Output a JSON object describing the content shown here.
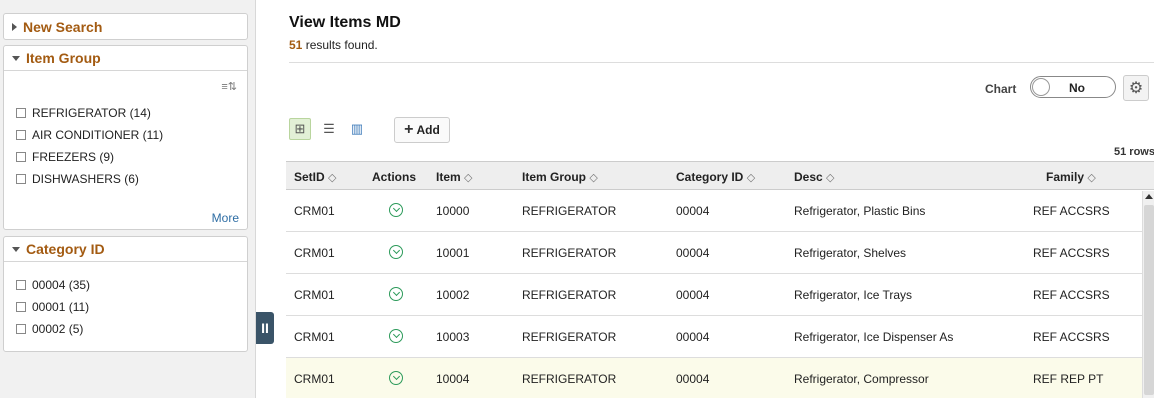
{
  "left_panel": {
    "new_search": {
      "label": "New Search"
    },
    "item_group": {
      "title": "Item Group",
      "options": [
        {
          "label": "REFRIGERATOR (14)"
        },
        {
          "label": "AIR CONDITIONER (11)"
        },
        {
          "label": "FREEZERS (9)"
        },
        {
          "label": "DISHWASHERS (6)"
        }
      ],
      "more": "More"
    },
    "category_id": {
      "title": "Category ID",
      "options": [
        {
          "label": "00004 (35)"
        },
        {
          "label": "00001 (11)"
        },
        {
          "label": "00002 (5)"
        }
      ]
    },
    "collapse_glyph": "II"
  },
  "main": {
    "title": "View Items MD",
    "results_count": "51",
    "results_text": "results found.",
    "chart_label": "Chart",
    "chart_toggle_value": "No",
    "add_label": "Add",
    "row_count": "51 rows"
  },
  "grid": {
    "columns": [
      "SetID",
      "Actions",
      "Item",
      "Item Group",
      "Category ID",
      "Desc",
      "Family"
    ],
    "rows": [
      {
        "setid": "CRM01",
        "item": "10000",
        "group": "REFRIGERATOR",
        "cat": "00004",
        "desc": "Refrigerator, Plastic Bins",
        "family": "REF ACCSRS"
      },
      {
        "setid": "CRM01",
        "item": "10001",
        "group": "REFRIGERATOR",
        "cat": "00004",
        "desc": "Refrigerator, Shelves",
        "family": "REF ACCSRS"
      },
      {
        "setid": "CRM01",
        "item": "10002",
        "group": "REFRIGERATOR",
        "cat": "00004",
        "desc": "Refrigerator, Ice Trays",
        "family": "REF ACCSRS"
      },
      {
        "setid": "CRM01",
        "item": "10003",
        "group": "REFRIGERATOR",
        "cat": "00004",
        "desc": "Refrigerator, Ice Dispenser As",
        "family": "REF ACCSRS"
      },
      {
        "setid": "CRM01",
        "item": "10004",
        "group": "REFRIGERATOR",
        "cat": "00004",
        "desc": "Refrigerator, Compressor",
        "family": "REF REP PT"
      }
    ]
  },
  "colors": {
    "accent": "#a35b12",
    "link": "#2e6da4",
    "action": "#2c9a5a",
    "highlight_row": "#fbfbea"
  }
}
